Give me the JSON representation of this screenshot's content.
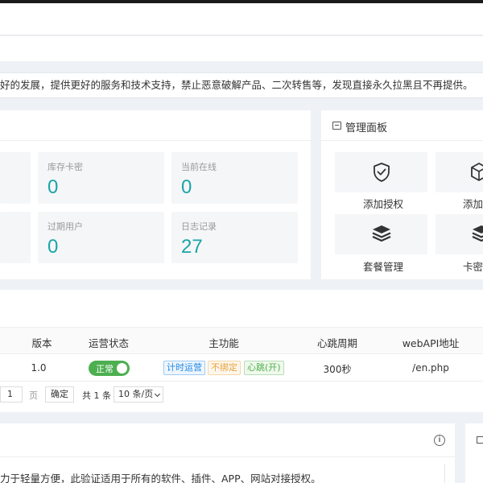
{
  "notice": {
    "text": "好的发展，提供更好的服务和技术支持，禁止恶意破解产品、二次转售等，发现直接永久拉黑且不再提供。"
  },
  "stats": [
    {
      "label": "",
      "value": ""
    },
    {
      "label": "库存卡密",
      "value": "0"
    },
    {
      "label": "当前在线",
      "value": "0"
    },
    {
      "label": "",
      "value": ""
    },
    {
      "label": "过期用户",
      "value": "0"
    },
    {
      "label": "日志记录",
      "value": "27"
    }
  ],
  "management": {
    "title": "管理面板",
    "tiles": [
      {
        "label": "添加授权",
        "icon": "shield-check-icon"
      },
      {
        "label": "添加",
        "icon": "box-icon"
      },
      {
        "label": "套餐管理",
        "icon": "layers-icon"
      },
      {
        "label": "卡密",
        "icon": "layers-icon"
      }
    ]
  },
  "table": {
    "headers": [
      "版本",
      "运营状态",
      "主功能",
      "心跳周期",
      "webAPI地址"
    ],
    "row": {
      "version": "1.0",
      "status": "正常",
      "tags": [
        "计时运营",
        "不绑定",
        "心跳(开)"
      ],
      "heartbeat": "300秒",
      "api": "/en.php"
    }
  },
  "pager": {
    "page": "1",
    "unit": "页",
    "confirm": "确定",
    "total": "共 1 条",
    "per_page": "10 条/页"
  },
  "bottom": {
    "text": "力于轻量方便，此验证适用于所有的软件、插件、APP、网站对接授权。",
    "info_icon": "info-icon"
  },
  "colors": {
    "accent": "#1aa5a9",
    "toggle": "#4caf50",
    "tag_blue": "#1e88e5",
    "tag_orange": "#e6a23c",
    "tag_green": "#4caf50"
  }
}
